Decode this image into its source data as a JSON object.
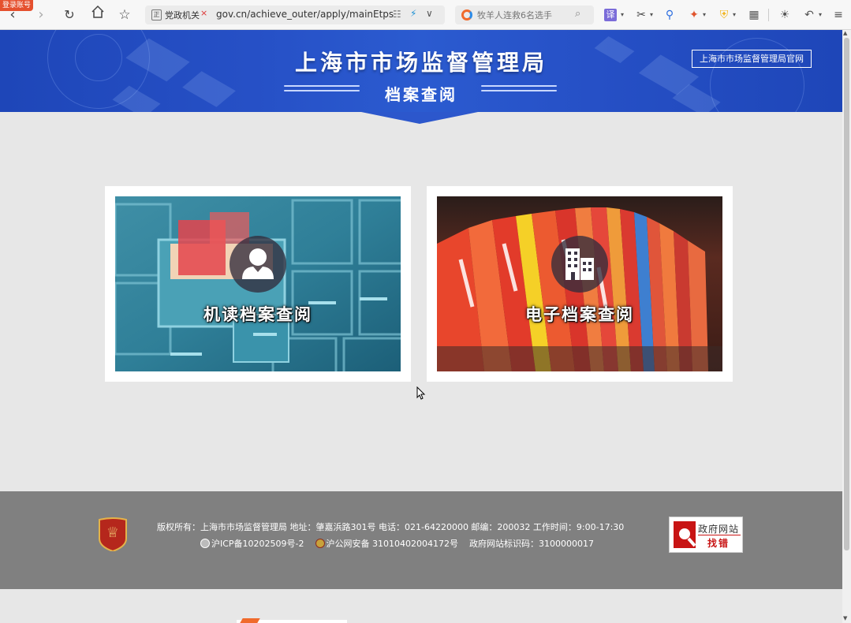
{
  "browser": {
    "login_badge": "登录账号",
    "address": {
      "site_name": "党政机关",
      "url": "gov.cn/achieve_outer/apply/mainEtps"
    },
    "search": {
      "placeholder": "牧羊人连救6名选手"
    },
    "translate_label": "译"
  },
  "header": {
    "title": "上海市市场监督管理局",
    "subtitle": "档案查阅",
    "official_site_link": "上海市市场监督管理局官网"
  },
  "cards": [
    {
      "label": "机读档案查阅",
      "icon": "person-icon"
    },
    {
      "label": "电子档案查阅",
      "icon": "building-icon"
    }
  ],
  "footer": {
    "copyright": "版权所有：上海市市场监督管理局 地址：肇嘉浜路301号 电话：021-64220000 邮编：200032 工作时间：9:00-17:30",
    "icp": "沪ICP备10202509号-2",
    "police": "沪公网安备 31010402004172号",
    "site_code": "政府网站标识码：3100000017",
    "badge_label": "党政机关",
    "findbug_line1": "政府网站",
    "findbug_line2": "找错"
  },
  "colors": {
    "banner_blue": "#2650c6",
    "footer_gray": "#808080",
    "page_bg": "#e7e7e7",
    "findbug_red": "#c81414"
  }
}
